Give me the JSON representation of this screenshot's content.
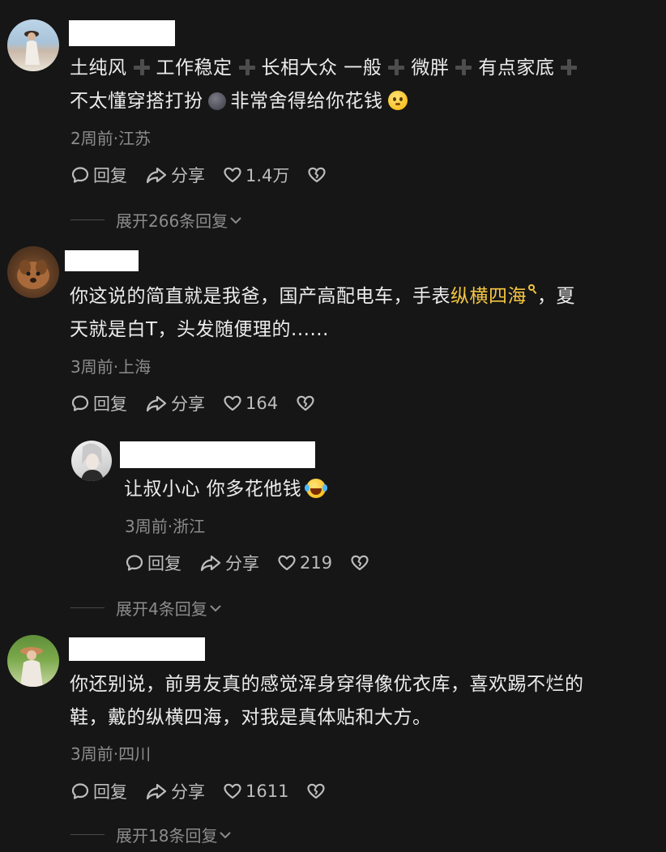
{
  "comments": [
    {
      "text_line1_segments": [
        "土纯风",
        "工作稳定",
        "长相大众 一般",
        "微胖",
        "有点家底"
      ],
      "text_line2_a": "不太懂穿搭打扮",
      "text_line2_b": "非常舍得给你花钱",
      "meta": "2周前·江苏",
      "reply_label": "回复",
      "share_label": "分享",
      "like_count": "1.4万",
      "expand_label": "展开266条回复"
    },
    {
      "text_line1_a": "你这说的简直就是我爸，国产高配电车，手表",
      "text_line1_link": "纵横四海",
      "text_line1_b": "，夏",
      "text_line2": "天就是白T，头发随便理的......",
      "meta": "3周前·上海",
      "reply_label": "回复",
      "share_label": "分享",
      "like_count": "164",
      "reply": {
        "text": "让叔小心 你多花他钱",
        "meta": "3周前·浙江",
        "reply_label": "回复",
        "share_label": "分享",
        "like_count": "219"
      },
      "expand_label": "展开4条回复"
    },
    {
      "text_line1": "你还别说，前男友真的感觉浑身穿得像优衣库，喜欢踢不烂的",
      "text_line2": "鞋，戴的纵横四海，对我是真体贴和大方。",
      "meta": "3周前·四川",
      "reply_label": "回复",
      "share_label": "分享",
      "like_count": "1611",
      "expand_label": "展开18条回复"
    }
  ],
  "icons": {
    "reply": "comment-bubble-icon",
    "share": "share-arrow-icon",
    "like": "heart-icon",
    "dislike": "broken-heart-icon",
    "expand": "chevron-down-icon"
  },
  "colors": {
    "background": "#161616",
    "highlight": "#f5c542",
    "meta": "#8c8c8c"
  }
}
